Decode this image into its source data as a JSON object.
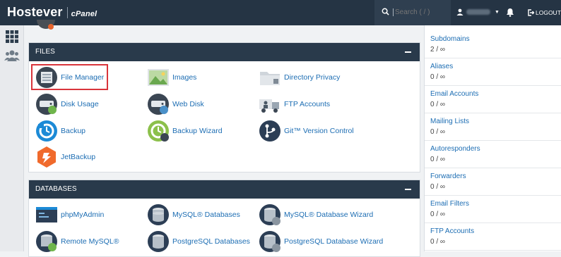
{
  "header": {
    "brand": "Hostever",
    "product": "cPanel",
    "search_placeholder": "Search ( / )",
    "logout_label": "LOGOUT"
  },
  "files_section": {
    "title": "FILES",
    "items": [
      {
        "label": "File Manager",
        "icon": "file-manager-icon"
      },
      {
        "label": "Images",
        "icon": "images-icon"
      },
      {
        "label": "Directory Privacy",
        "icon": "folder-icon"
      },
      {
        "label": "Disk Usage",
        "icon": "disk-usage-icon"
      },
      {
        "label": "Web Disk",
        "icon": "web-disk-icon"
      },
      {
        "label": "FTP Accounts",
        "icon": "ftp-truck-icon"
      },
      {
        "label": "Backup",
        "icon": "backup-icon"
      },
      {
        "label": "Backup Wizard",
        "icon": "backup-wizard-icon"
      },
      {
        "label": "Git™ Version Control",
        "icon": "git-icon"
      },
      {
        "label": "JetBackup",
        "icon": "jetbackup-icon"
      }
    ]
  },
  "databases_section": {
    "title": "DATABASES",
    "items": [
      {
        "label": "phpMyAdmin",
        "icon": "phpmyadmin-icon"
      },
      {
        "label": "MySQL® Databases",
        "icon": "database-icon"
      },
      {
        "label": "MySQL® Database Wizard",
        "icon": "database-wizard-icon"
      },
      {
        "label": "Remote MySQL®",
        "icon": "remote-database-icon"
      },
      {
        "label": "PostgreSQL Databases",
        "icon": "database-icon"
      },
      {
        "label": "PostgreSQL Database Wizard",
        "icon": "database-wizard-icon"
      }
    ]
  },
  "stats": [
    {
      "label": "Subdomains",
      "value": "2 / ∞"
    },
    {
      "label": "Aliases",
      "value": "0 / ∞"
    },
    {
      "label": "Email Accounts",
      "value": "0 / ∞"
    },
    {
      "label": "Mailing Lists",
      "value": "0 / ∞"
    },
    {
      "label": "Autoresponders",
      "value": "0 / ∞"
    },
    {
      "label": "Forwarders",
      "value": "0 / ∞"
    },
    {
      "label": "Email Filters",
      "value": "0 / ∞"
    },
    {
      "label": "FTP Accounts",
      "value": "0 / ∞"
    }
  ],
  "colors": {
    "topbar": "#253444",
    "panel_header": "#293a4b",
    "link": "#1c6db3",
    "highlight": "#d9343b"
  }
}
